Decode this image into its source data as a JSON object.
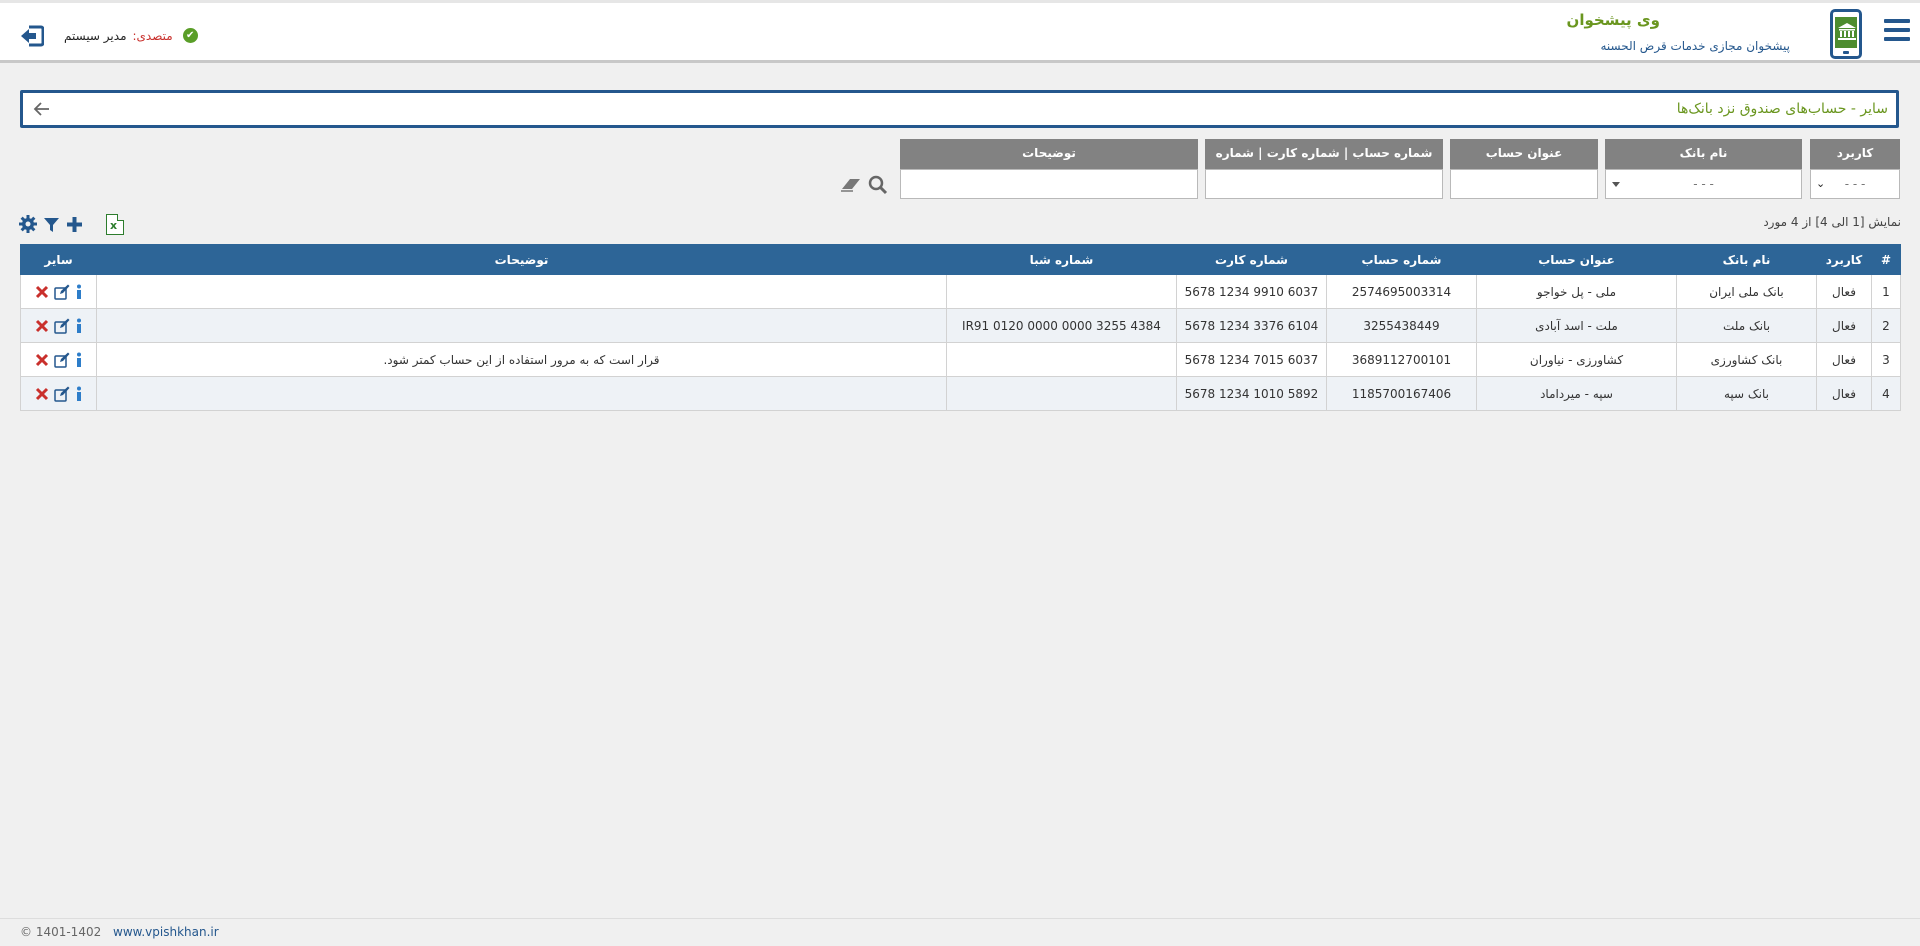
{
  "header": {
    "brand_title": "وی پیشخوان",
    "brand_subtitle": "پیشخوان مجازی خدمات قرض الحسنه",
    "user_label": "متصدی:",
    "user_name": "مدیر سیستم"
  },
  "page": {
    "title": "سایر - حساب‌های صندوق نزد بانک‌ها"
  },
  "filters": {
    "usage": {
      "label": "کاربرد",
      "value": "- - -"
    },
    "bank_name": {
      "label": "نام بانک",
      "value": "- - -"
    },
    "account_title": {
      "label": "عنوان حساب",
      "value": ""
    },
    "numbers": {
      "label": "شماره حساب | شماره کارت | شماره شبا",
      "value": ""
    },
    "description": {
      "label": "توضیحات",
      "value": ""
    }
  },
  "listing": {
    "showing_text": "نمایش [1 الی 4] از 4 مورد"
  },
  "table": {
    "headers": {
      "index": "#",
      "usage": "کاربرد",
      "bank": "نام بانک",
      "title": "عنوان حساب",
      "account": "شماره حساب",
      "card": "شماره کارت",
      "iban": "شماره شبا",
      "desc": "توضیحات",
      "other": "سایر"
    },
    "rows": [
      {
        "index": "1",
        "usage": "فعال",
        "bank": "بانک ملی ایران",
        "title": "ملی - پل خواجو",
        "account": "2574695003314",
        "card": "6037 9910 1234 5678",
        "iban": "",
        "desc": ""
      },
      {
        "index": "2",
        "usage": "فعال",
        "bank": "بانک ملت",
        "title": "ملت - اسد آبادی",
        "account": "3255438449",
        "card": "6104 3376 1234 5678",
        "iban": "IR91 0120 0000 0000 3255 4384",
        "desc": ""
      },
      {
        "index": "3",
        "usage": "فعال",
        "bank": "بانک کشاورزی",
        "title": "کشاورزی - نیاوران",
        "account": "3689112700101",
        "card": "6037 7015 1234 5678",
        "iban": "",
        "desc": "قرار است که به مرور استفاده از این حساب کمتر شود."
      },
      {
        "index": "4",
        "usage": "فعال",
        "bank": "بانک سپه",
        "title": "سپه - میرداماد",
        "account": "1185700167406",
        "card": "5892 1010 1234 5678",
        "iban": "",
        "desc": ""
      }
    ]
  },
  "footer": {
    "copyright": "© 1401-1402",
    "website": "www.vpishkhan.ir"
  },
  "colors": {
    "primary": "#24578d",
    "table_header": "#2d6597",
    "brand_green": "#6a961f",
    "delete_red": "#c9302c",
    "excel_green": "#2d7d2d"
  },
  "icons": [
    "menu-icon",
    "bank-logo-icon",
    "check-circle-icon",
    "logout-icon",
    "back-arrow-icon",
    "eraser-icon",
    "search-icon",
    "excel-icon",
    "add-icon",
    "filter-icon",
    "settings-icon",
    "info-icon",
    "edit-icon",
    "delete-icon"
  ]
}
